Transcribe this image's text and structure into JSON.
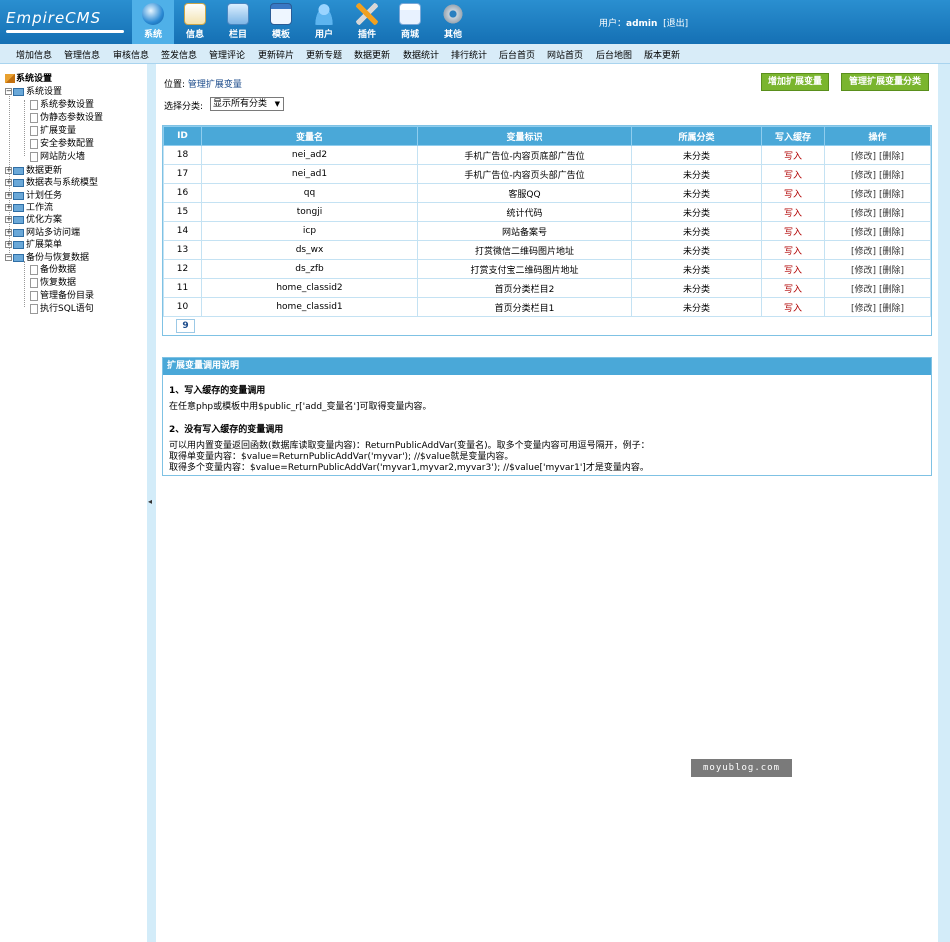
{
  "app": {
    "logo": "EmpireCMS"
  },
  "nav": [
    {
      "label": "系统",
      "icon": "globe-icon",
      "active": true
    },
    {
      "label": "信息",
      "icon": "notepad-icon"
    },
    {
      "label": "栏目",
      "icon": "folder-icon"
    },
    {
      "label": "模板",
      "icon": "window-icon"
    },
    {
      "label": "用户",
      "icon": "user-icon"
    },
    {
      "label": "插件",
      "icon": "tools-icon"
    },
    {
      "label": "商城",
      "icon": "shop-icon"
    },
    {
      "label": "其他",
      "icon": "gear-icon"
    }
  ],
  "user": {
    "prefix": "用户：",
    "name": "admin",
    "logout": "[退出]"
  },
  "subnav": [
    "增加信息",
    "管理信息",
    "审核信息",
    "签发信息",
    "管理评论",
    "更新碎片",
    "更新专题",
    "数据更新",
    "数据统计",
    "排行统计",
    "后台首页",
    "网站首页",
    "后台地图",
    "版本更新"
  ],
  "sidebar": {
    "root": "系统设置",
    "items": [
      {
        "label": "系统设置",
        "level": 0,
        "open": true
      },
      {
        "label": "系统参数设置",
        "level": 1
      },
      {
        "label": "伪静态参数设置",
        "level": 1
      },
      {
        "label": "扩展变量",
        "level": 1
      },
      {
        "label": "安全参数配置",
        "level": 1
      },
      {
        "label": "网站防火墙",
        "level": 1
      },
      {
        "label": "数据更新",
        "level": 0
      },
      {
        "label": "数据表与系统模型",
        "level": 0
      },
      {
        "label": "计划任务",
        "level": 0
      },
      {
        "label": "工作流",
        "level": 0
      },
      {
        "label": "优化方案",
        "level": 0
      },
      {
        "label": "网站多访问端",
        "level": 0
      },
      {
        "label": "扩展菜单",
        "level": 0
      },
      {
        "label": "备份与恢复数据",
        "level": 0,
        "open": true
      },
      {
        "label": "备份数据",
        "level": 1
      },
      {
        "label": "恢复数据",
        "level": 1
      },
      {
        "label": "管理备份目录",
        "level": 1
      },
      {
        "label": "执行SQL语句",
        "level": 1
      }
    ]
  },
  "main": {
    "pos_label": "位置:",
    "pos_link": "管理扩展变量",
    "btn_add": "增加扩展变量",
    "btn_manage": "管理扩展变量分类",
    "cat_label": "选择分类:",
    "cat_value": "显示所有分类",
    "headers": [
      "ID",
      "变量名",
      "变量标识",
      "所属分类",
      "写入缓存",
      "操作"
    ],
    "rows": [
      {
        "id": "18",
        "name": "nei_ad2",
        "title": "手机广告位-内容页底部广告位",
        "cat": "未分类",
        "cache": "写入",
        "edit": "[修改]",
        "del": "[删除]"
      },
      {
        "id": "17",
        "name": "nei_ad1",
        "title": "手机广告位-内容页头部广告位",
        "cat": "未分类",
        "cache": "写入",
        "edit": "[修改]",
        "del": "[删除]"
      },
      {
        "id": "16",
        "name": "qq",
        "title": "客服QQ",
        "cat": "未分类",
        "cache": "写入",
        "edit": "[修改]",
        "del": "[删除]"
      },
      {
        "id": "15",
        "name": "tongji",
        "title": "统计代码",
        "cat": "未分类",
        "cache": "写入",
        "edit": "[修改]",
        "del": "[删除]"
      },
      {
        "id": "14",
        "name": "icp",
        "title": "网站备案号",
        "cat": "未分类",
        "cache": "写入",
        "edit": "[修改]",
        "del": "[删除]"
      },
      {
        "id": "13",
        "name": "ds_wx",
        "title": "打赏微信二维码图片地址",
        "cat": "未分类",
        "cache": "写入",
        "edit": "[修改]",
        "del": "[删除]"
      },
      {
        "id": "12",
        "name": "ds_zfb",
        "title": "打赏支付宝二维码图片地址",
        "cat": "未分类",
        "cache": "写入",
        "edit": "[修改]",
        "del": "[删除]"
      },
      {
        "id": "11",
        "name": "home_classid2",
        "title": "首页分类栏目2",
        "cat": "未分类",
        "cache": "写入",
        "edit": "[修改]",
        "del": "[删除]"
      },
      {
        "id": "10",
        "name": "home_classid1",
        "title": "首页分类栏目1",
        "cat": "未分类",
        "cache": "写入",
        "edit": "[修改]",
        "del": "[删除]"
      }
    ],
    "pager": "9"
  },
  "help": {
    "title": "扩展变量调用说明",
    "h1": "1、写入缓存的变量调用",
    "p1": "在任意php或模板中用$public_r['add_变量名']可取得变量内容。",
    "h2": "2、没有写入缓存的变量调用",
    "p2": "可以用内置变量返回函数(数据库读取变量内容)：ReturnPublicAddVar(变量名)。取多个变量内容可用逗号隔开，例子：",
    "p3": "取得单变量内容：$value=ReturnPublicAddVar('myvar'); //$value就是变量内容。",
    "p4": "取得多个变量内容：$value=ReturnPublicAddVar('myvar1,myvar2,myvar3'); //$value['myvar1']才是变量内容。"
  },
  "watermark": "moyublog.com",
  "colors": {
    "topbar": "#1f82c6",
    "subnav": "#d8ecf8",
    "table_head": "#4aa8d8",
    "green_btn": "#7ab52e",
    "red_text": "#b00000"
  }
}
